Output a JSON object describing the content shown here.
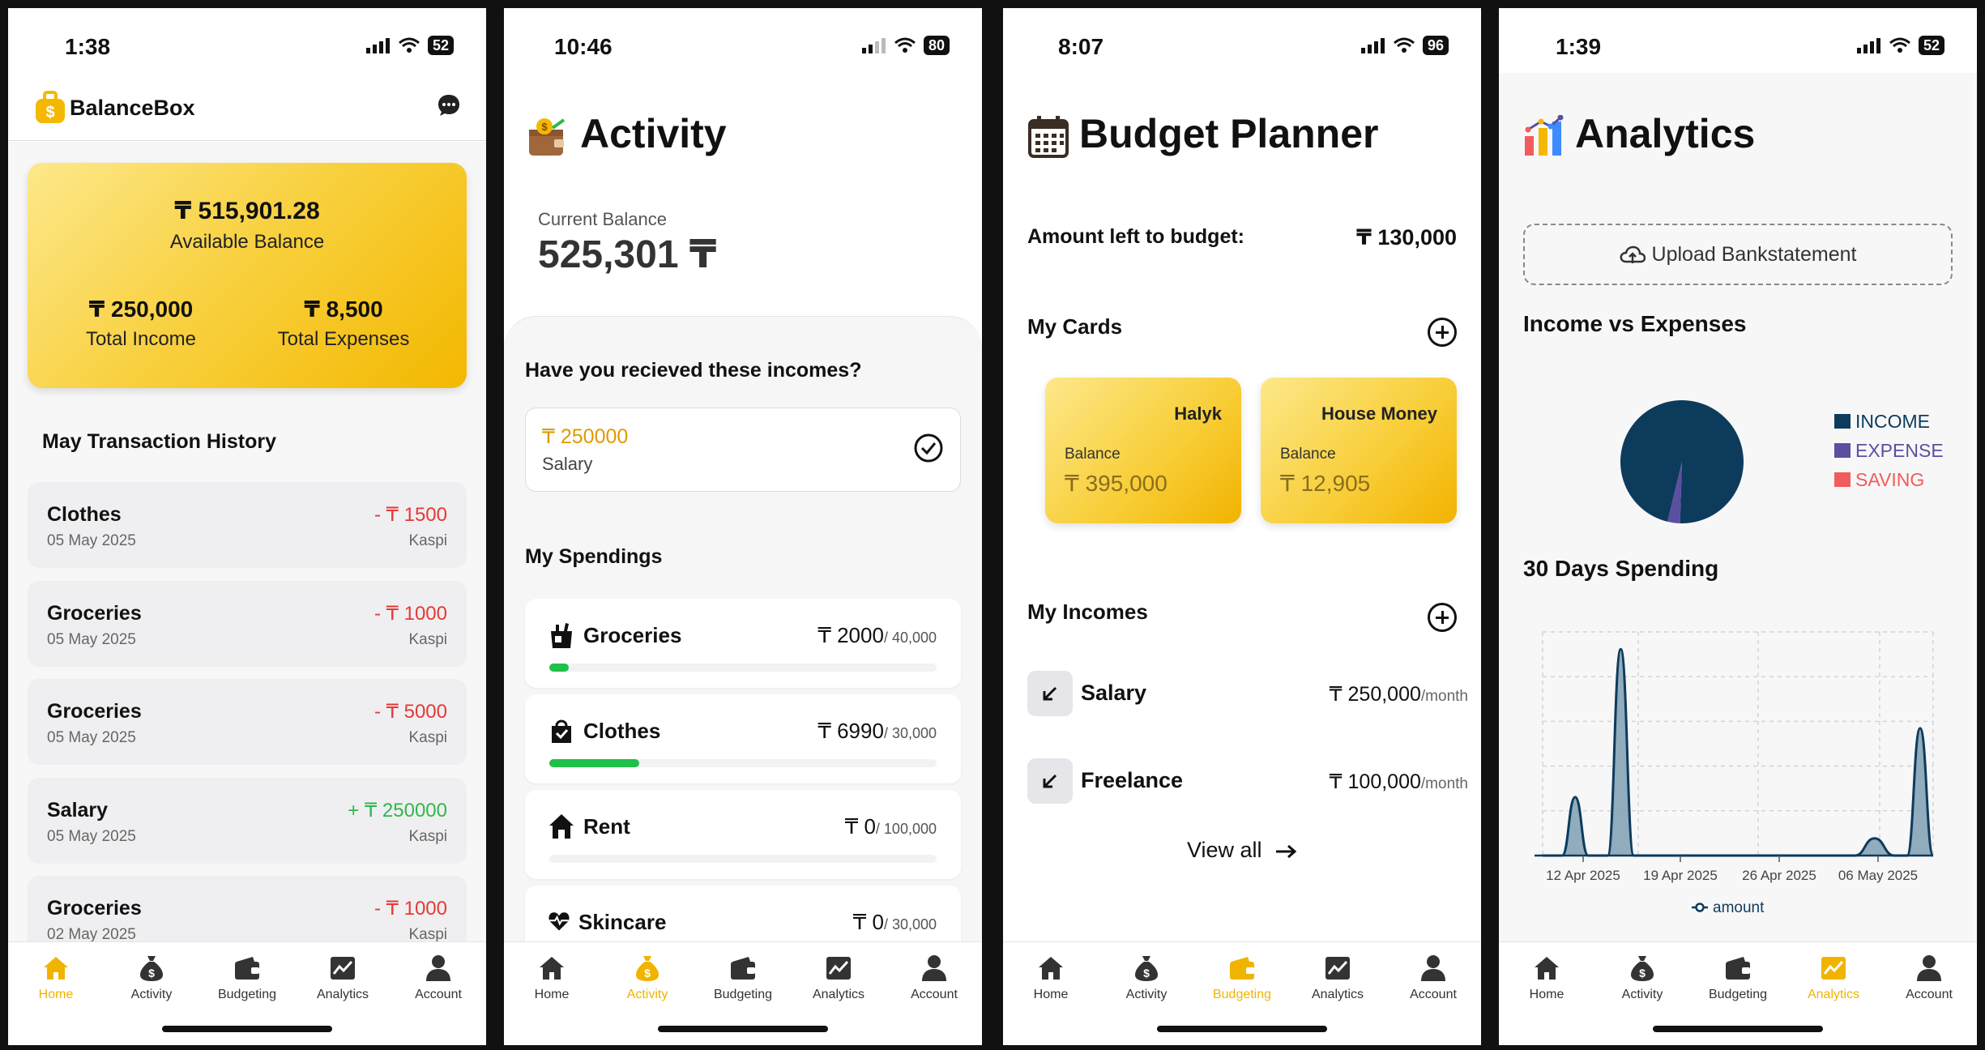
{
  "status": {
    "home": {
      "time": "1:38",
      "battery": "52"
    },
    "activity": {
      "time": "10:46",
      "battery": "80"
    },
    "budget": {
      "time": "8:07",
      "battery": "96"
    },
    "analytics": {
      "time": "1:39",
      "battery": "52"
    }
  },
  "tabs": [
    "Home",
    "Activity",
    "Budgeting",
    "Analytics",
    "Account"
  ],
  "home": {
    "app_name": "BalanceBox",
    "available_balance": "₸ 515,901.28",
    "available_label": "Available Balance",
    "income_value": "₸ 250,000",
    "income_label": "Total Income",
    "expense_value": "₸ 8,500",
    "expense_label": "Total Expenses",
    "history_title": "May Transaction History",
    "transactions": [
      {
        "name": "Clothes",
        "date": "05 May 2025",
        "amount": "- ₸ 1500",
        "bank": "Kaspi"
      },
      {
        "name": "Groceries",
        "date": "05 May 2025",
        "amount": "- ₸ 1000",
        "bank": "Kaspi"
      },
      {
        "name": "Groceries",
        "date": "05 May 2025",
        "amount": "- ₸ 5000",
        "bank": "Kaspi"
      },
      {
        "name": "Salary",
        "date": "05 May 2025",
        "amount": "+ ₸ 250000",
        "bank": "Kaspi"
      },
      {
        "name": "Groceries",
        "date": "02 May 2025",
        "amount": "- ₸ 1000",
        "bank": "Kaspi"
      }
    ]
  },
  "activity": {
    "title": "Activity",
    "balance_label": "Current Balance",
    "balance_value": "525,301 ₸",
    "incomes_question": "Have you recieved these incomes?",
    "pending_amount": "₸ 250000",
    "pending_name": "Salary",
    "spendings_title": "My Spendings",
    "spendings": [
      {
        "name": "Groceries",
        "amount": "₸ 2000",
        "limit": "/ 40,000",
        "progress": 0.05
      },
      {
        "name": "Clothes",
        "amount": "₸ 6990",
        "limit": "/ 30,000",
        "progress": 0.233
      },
      {
        "name": "Rent",
        "amount": "₸ 0",
        "limit": "/ 100,000",
        "progress": 0
      },
      {
        "name": "Skincare",
        "amount": "₸ 0",
        "limit": "/ 30,000",
        "progress": 0
      }
    ]
  },
  "budget": {
    "title": "Budget Planner",
    "left_label": "Amount left to budget:",
    "left_value": "₸ 130,000",
    "cards_title": "My Cards",
    "cards": [
      {
        "name": "Halyk",
        "label": "Balance",
        "value": "₸ 395,000"
      },
      {
        "name": "House Money",
        "label": "Balance",
        "value": "₸ 12,905"
      }
    ],
    "incomes_title": "My Incomes",
    "incomes": [
      {
        "name": "Salary",
        "amount": "₸ 250,000",
        "period": "/month"
      },
      {
        "name": "Freelance",
        "amount": "₸ 100,000",
        "period": "/month"
      }
    ],
    "view_all": "View all"
  },
  "analytics": {
    "title": "Analytics",
    "upload_label": "Upload Bankstatement",
    "pie_title": "Income vs Expenses",
    "spending_title": "30 Days Spending",
    "colors": {
      "income": "#0d3b5c",
      "expense": "#5b4fa0",
      "saving": "#f25c5c",
      "accent": "#f0b400"
    }
  },
  "chart_data": [
    {
      "type": "pie",
      "title": "Income vs Expenses",
      "categories": [
        "INCOME",
        "EXPENSE",
        "SAVING"
      ],
      "values": [
        250000,
        8500,
        0
      ],
      "colors": [
        "#0d3b5c",
        "#5b4fa0",
        "#f25c5c"
      ],
      "legend": "right"
    },
    {
      "type": "area",
      "title": "30 Days Spending",
      "x_ticks": [
        "12 Apr 2025",
        "19 Apr 2025",
        "26 Apr 2025",
        "06 May 2025"
      ],
      "series": [
        {
          "name": "amount",
          "points": [
            {
              "x": 0,
              "y": 0
            },
            {
              "x": 1.5,
              "y": 0
            },
            {
              "x": 2.5,
              "y": 1700
            },
            {
              "x": 3.5,
              "y": 0
            },
            {
              "x": 5,
              "y": 0
            },
            {
              "x": 6,
              "y": 6000
            },
            {
              "x": 7,
              "y": 0
            },
            {
              "x": 24,
              "y": 0
            },
            {
              "x": 25.5,
              "y": 500
            },
            {
              "x": 27,
              "y": 0
            },
            {
              "x": 28,
              "y": 0
            },
            {
              "x": 29,
              "y": 3700
            },
            {
              "x": 30,
              "y": 0
            }
          ]
        }
      ],
      "xlim": [
        0,
        30
      ],
      "ylim": [
        0,
        6500
      ],
      "grid": true,
      "legend": "bottom"
    }
  ]
}
